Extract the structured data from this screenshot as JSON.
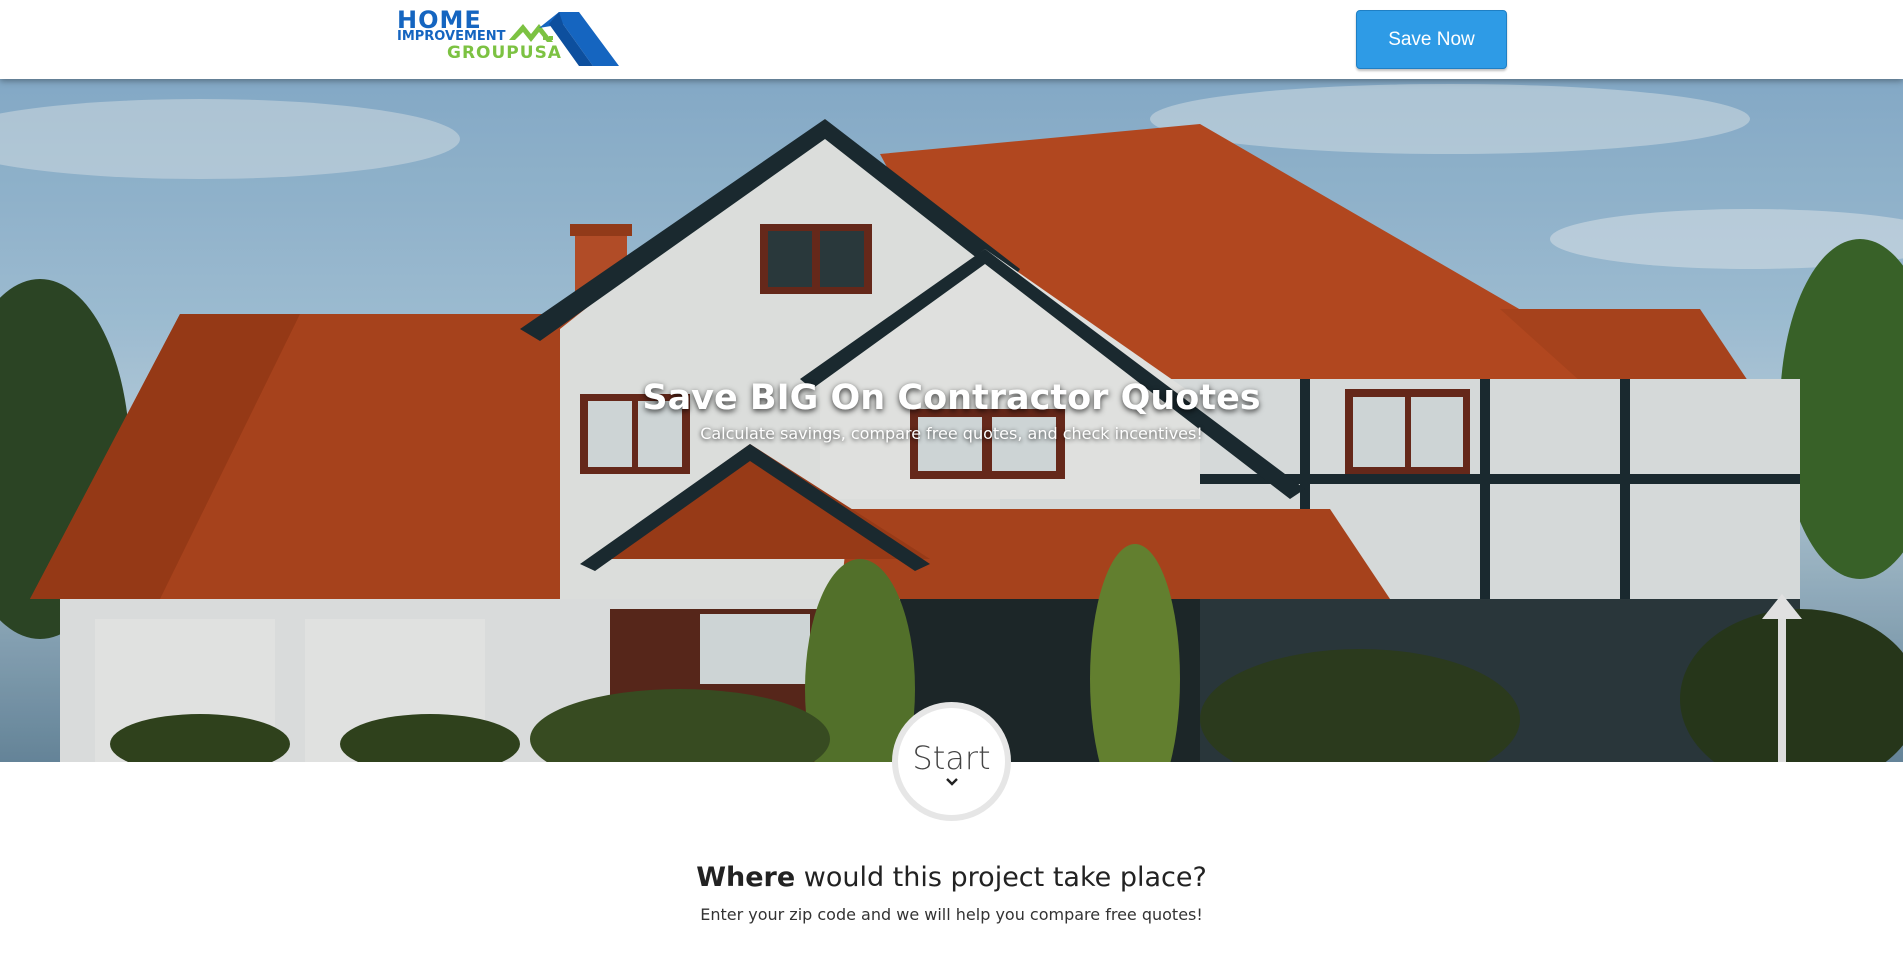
{
  "header": {
    "logo": {
      "line1": "HOME",
      "line2": "IMPROVEMENT",
      "line3": "GROUPUSA",
      "colors": {
        "blue": "#1565c0",
        "green": "#7cc242"
      }
    },
    "cta_label": "Save Now",
    "cta_color": "#2e9be6"
  },
  "hero": {
    "title": "Save BIG On Contractor Quotes",
    "subtitle": "Calculate savings, compare free quotes, and check incentives!",
    "background": "house-with-red-tile-roof-photo"
  },
  "start": {
    "label": "Start",
    "icon": "chevron-down-icon"
  },
  "question": {
    "bold": "Where",
    "rest": " would this project take place?",
    "subtitle": "Enter your zip code and we will help you compare free quotes!"
  }
}
